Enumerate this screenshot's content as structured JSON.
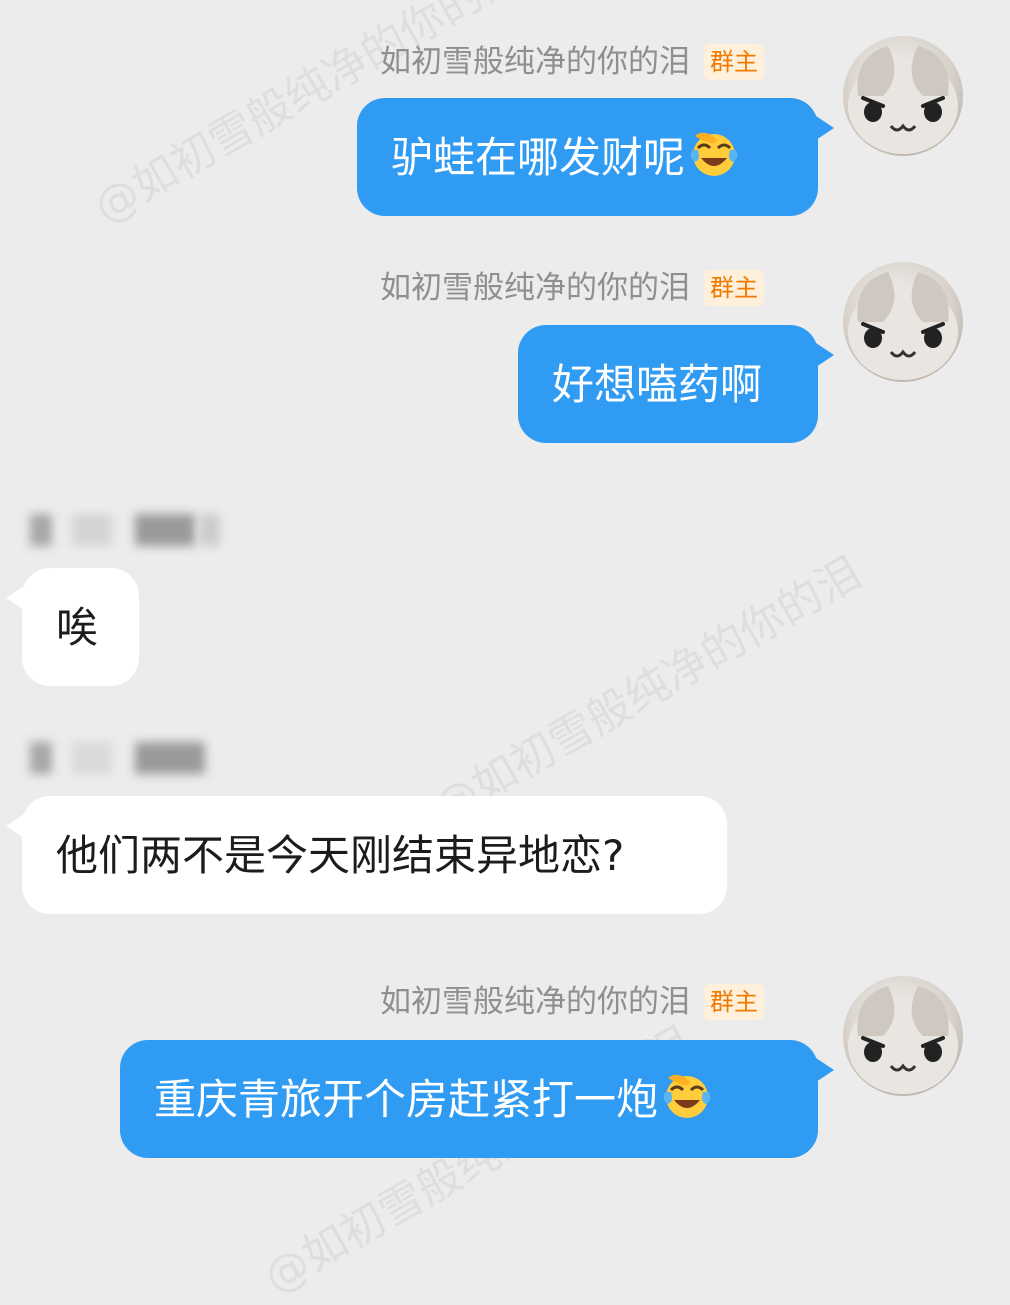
{
  "watermark_text": "@如初雪般纯净的你的泪",
  "messages": [
    {
      "sender": "如初雪般纯净的你的泪",
      "badge": "群主",
      "text": "驴蛙在哪发财呢",
      "emoji": "laughing-crying-emoji"
    },
    {
      "sender": "如初雪般纯净的你的泪",
      "badge": "群主",
      "text": "好想嗑药啊"
    },
    {
      "text": "唉"
    },
    {
      "text": "他们两不是今天刚结束异地恋?"
    },
    {
      "sender": "如初雪般纯净的你的泪",
      "badge": "群主",
      "text": "重庆青旅开个房赶紧打一炮",
      "emoji": "laughing-crying-emoji"
    }
  ],
  "colors": {
    "background": "#ececec",
    "my_bubble": "#2f9bf2",
    "other_bubble": "#ffffff",
    "badge_text": "#f07a00",
    "badge_bg": "#fff0dc",
    "name_text": "#8f8f8f"
  }
}
